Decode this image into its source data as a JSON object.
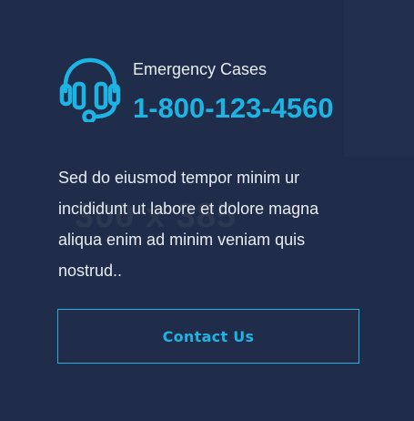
{
  "watermark": "300 x 385",
  "emergency": {
    "icon": "headset-icon",
    "label": "Emergency Cases",
    "phone": "1-800-123-4560"
  },
  "description": "Sed do eiusmod tempor minim ur incididunt ut labore et dolore magna aliqua enim ad minim veniam quis nostrud..",
  "contact_button": {
    "label": "Contact Us"
  },
  "colors": {
    "background": "#1f2d4b",
    "accent": "#1db4e4",
    "text": "#e8ecf3"
  }
}
